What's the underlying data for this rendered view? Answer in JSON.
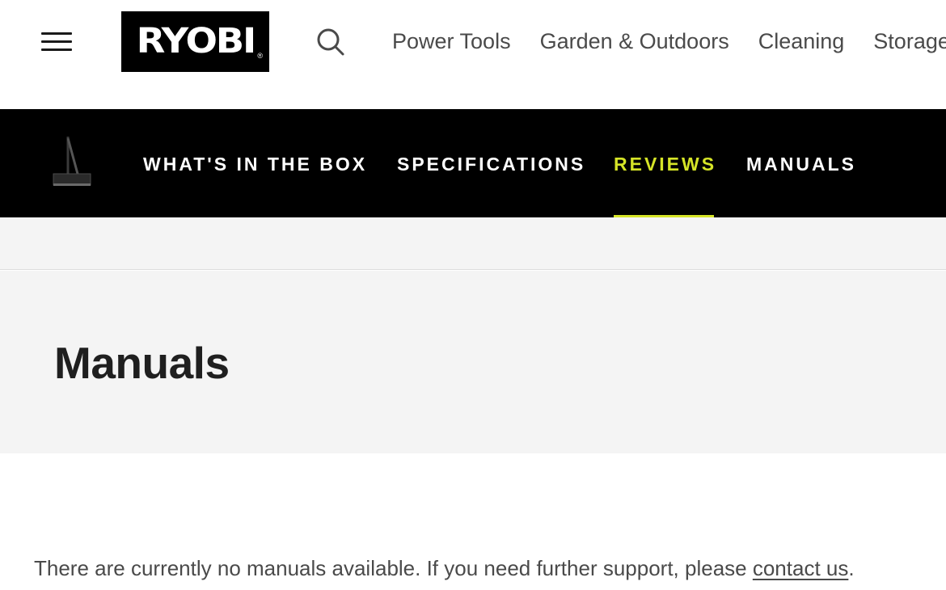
{
  "header": {
    "logo_text": "RYOBI",
    "logo_reg": "®",
    "nav_items": [
      "Power Tools",
      "Garden & Outdoors",
      "Cleaning",
      "Storage"
    ]
  },
  "product_nav": {
    "items": [
      {
        "label": "WHAT'S IN THE BOX",
        "active": false
      },
      {
        "label": "SPECIFICATIONS",
        "active": false
      },
      {
        "label": "REVIEWS",
        "active": true
      },
      {
        "label": "MANUALS",
        "active": false
      }
    ]
  },
  "manuals": {
    "title": "Manuals",
    "notice_text": "There are currently no manuals available. If you need further support, please ",
    "contact_link": "contact us",
    "notice_end": "."
  },
  "colors": {
    "accent": "#d5e427",
    "nav_bg": "#000000",
    "section_bg": "#f4f4f4"
  }
}
